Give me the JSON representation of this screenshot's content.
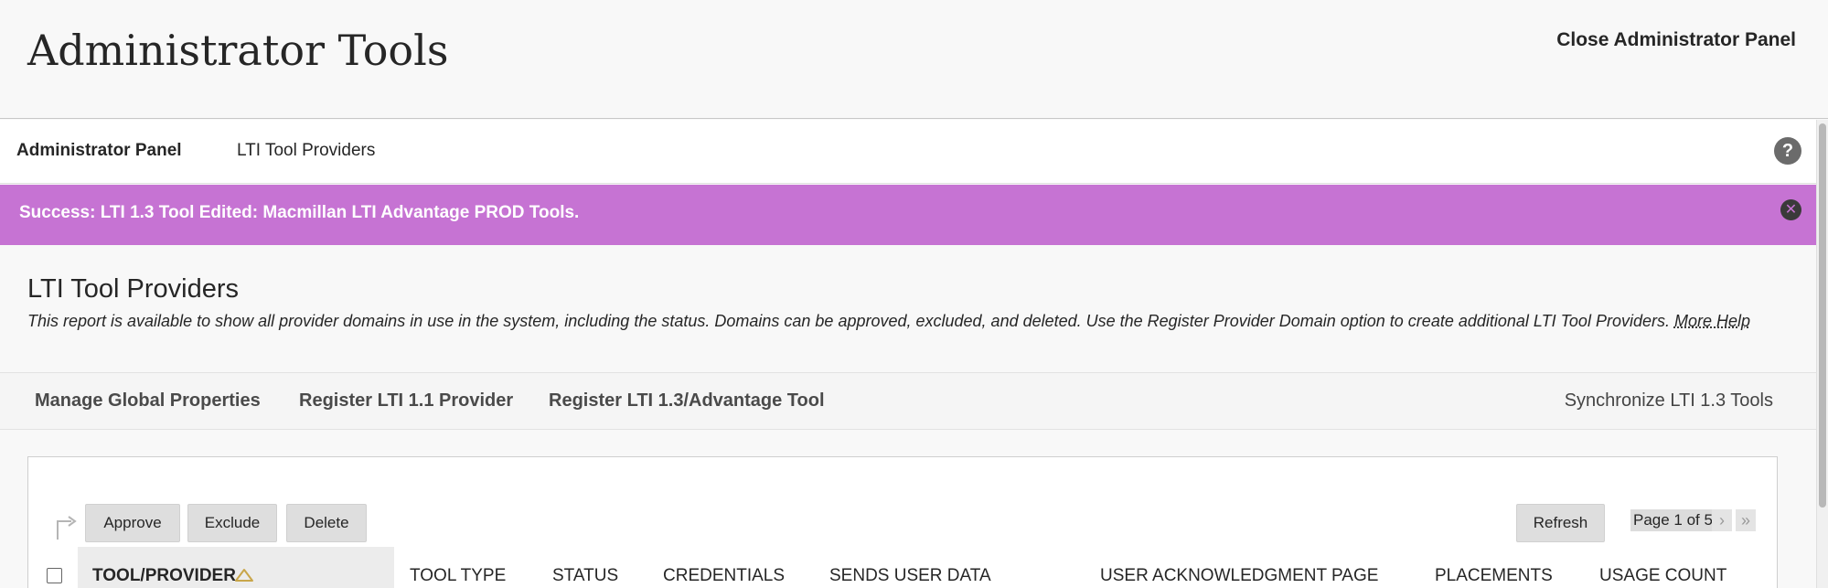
{
  "header": {
    "title": "Administrator Tools",
    "close_label": "Close Administrator Panel"
  },
  "breadcrumb": {
    "root": "Administrator Panel",
    "current": "LTI Tool Providers",
    "help_glyph": "?"
  },
  "success": {
    "message": "Success: LTI 1.3 Tool Edited: Macmillan LTI Advantage PROD Tools.",
    "close_glyph": "✕",
    "color": "#c673d3"
  },
  "page": {
    "heading": "LTI Tool Providers",
    "description": "This report is available to show all provider domains in use in the system, including the status. Domains can be approved, excluded, and deleted. Use the Register Provider Domain option to create additional LTI Tool Providers.",
    "more_help": "More Help"
  },
  "action_bar": {
    "manage": "Manage Global Properties",
    "register_11": "Register LTI 1.1 Provider",
    "register_13": "Register LTI 1.3/Advantage Tool",
    "synchronize": "Synchronize LTI 1.3 Tools"
  },
  "list_actions": {
    "approve": "Approve",
    "exclude": "Exclude",
    "delete": "Delete",
    "refresh": "Refresh"
  },
  "paging": {
    "label": "Page 1 of 5",
    "next_glyph": "›",
    "last_glyph": "»"
  },
  "columns": {
    "tool_provider": "TOOL/PROVIDER",
    "tool_type": "TOOL TYPE",
    "status": "STATUS",
    "credentials": "CREDENTIALS",
    "sends_user_data": "SENDS USER DATA",
    "user_ack_page": "USER ACKNOWLEDGMENT PAGE",
    "placements": "PLACEMENTS",
    "usage_count": "USAGE COUNT"
  },
  "icons": {
    "help": "help-icon",
    "close": "close-icon",
    "sort": "sort-ascending-icon",
    "select_arrow": "bulk-select-arrow-icon"
  }
}
